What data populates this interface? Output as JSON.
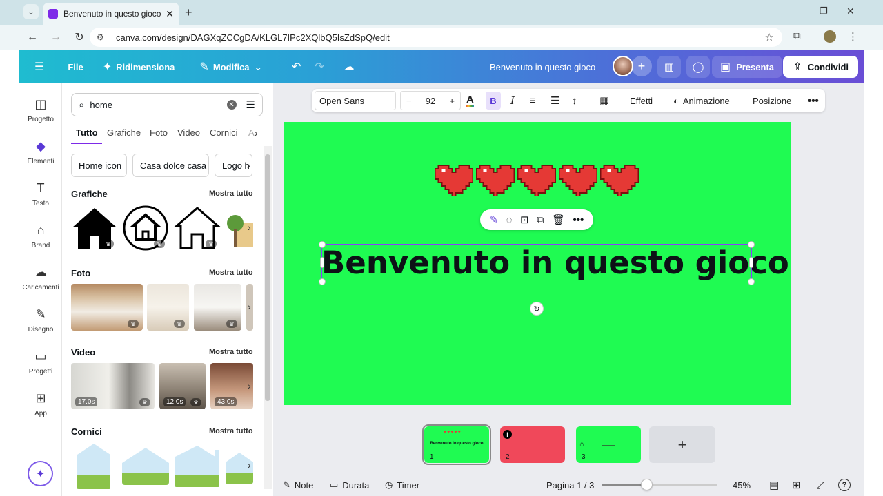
{
  "browser": {
    "tab_title": "Benvenuto in questo gioco - Pr",
    "url": "canva.com/design/DAGXqZCCgDA/KLGL7IPc2XQlbQ5IsZdSpQ/edit"
  },
  "header": {
    "menu_file": "File",
    "menu_resize": "Ridimensiona",
    "menu_edit": "Modifica",
    "doc_title": "Benvenuto in questo gioco",
    "present": "Presenta",
    "share": "Condividi"
  },
  "rail": {
    "items": [
      {
        "label": "Progetto"
      },
      {
        "label": "Elementi"
      },
      {
        "label": "Testo"
      },
      {
        "label": "Brand"
      },
      {
        "label": "Caricamenti"
      },
      {
        "label": "Disegno"
      },
      {
        "label": "Progetti"
      },
      {
        "label": "App"
      }
    ]
  },
  "panel": {
    "search_value": "home",
    "tabs": [
      "Tutto",
      "Grafiche",
      "Foto",
      "Video",
      "Cornici",
      "A"
    ],
    "chips": [
      "Home icon",
      "Casa dolce casa",
      "Logo h"
    ],
    "sections": {
      "graphics": "Grafiche",
      "photos": "Foto",
      "videos": "Video",
      "frames": "Cornici"
    },
    "see_all": "Mostra tutto",
    "video_durations": [
      "17.0s",
      "12.0s",
      "43.0s"
    ]
  },
  "toolbar": {
    "font": "Open Sans",
    "size": "92",
    "effects": "Effetti",
    "animation": "Animazione",
    "position": "Posizione"
  },
  "canvas": {
    "text": "Benvenuto in questo gioco",
    "background": "#1ffb52",
    "hearts": 5
  },
  "pages": {
    "numbers": [
      "1",
      "2",
      "3"
    ],
    "thumb1_text": "Benvenuto in questo gioco"
  },
  "footer": {
    "notes": "Note",
    "duration": "Durata",
    "timer": "Timer",
    "page_indicator": "Pagina 1 / 3",
    "zoom": "45%",
    "zoom_fraction": 0.45
  },
  "colors": {
    "accent": "#8b3dff",
    "share_bg": "#ffffff",
    "page2_bg": "#f0485a"
  }
}
